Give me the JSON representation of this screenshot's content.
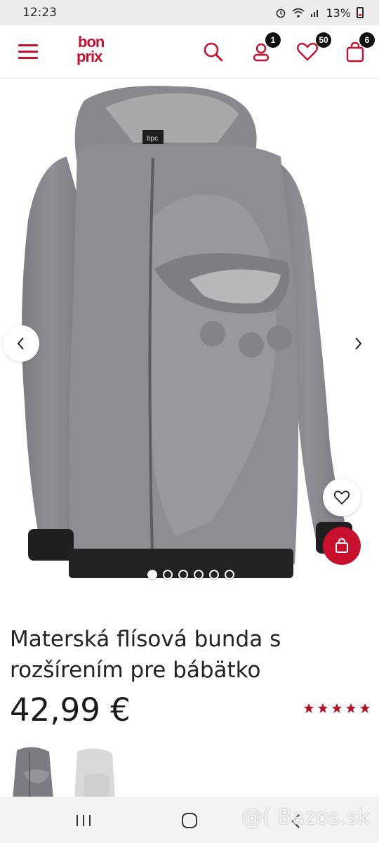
{
  "status_bar": {
    "time": "12:23",
    "battery": "13%"
  },
  "header": {
    "logo_line1": "bon",
    "logo_line2": "prix",
    "account_badge": "1",
    "wishlist_badge": "50",
    "cart_badge": "6"
  },
  "gallery": {
    "slide_count": 6,
    "active_slide": 1
  },
  "product": {
    "title": "Materská flísová bunda s rozšírením pre bábätko",
    "price": "42,99 €",
    "rating_stars": 5
  },
  "watermark": "@( Bazos.sk",
  "colors": {
    "brand": "#c8102e",
    "fleece": "#8c8a8f",
    "fleece_dark": "#6f6d72"
  },
  "icons": [
    "menu-icon",
    "search-icon",
    "user-icon",
    "heart-icon",
    "bag-icon",
    "chevron-left-icon",
    "chevron-right-icon",
    "star-icon"
  ]
}
